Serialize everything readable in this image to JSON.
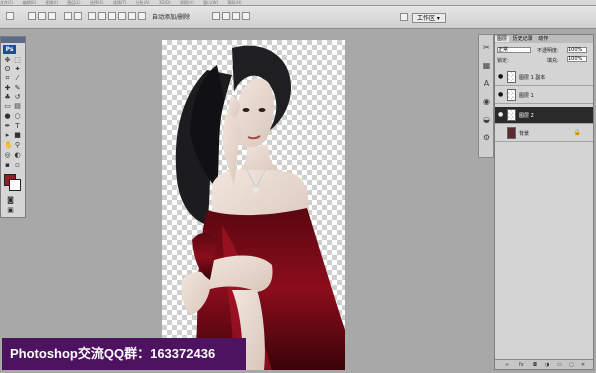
{
  "menubar": [
    "文件(F)",
    "编辑(E)",
    "图像(I)",
    "图层(L)",
    "选择(S)",
    "滤镜(T)",
    "分析(A)",
    "3D(D)",
    "视图(V)",
    "窗口(W)",
    "帮助(H)"
  ],
  "options": {
    "autoadd_label": "自动添加/删除",
    "workspace_label": "工作区 ▾"
  },
  "tools": {
    "logo": "Ps",
    "icons": [
      "move-tool",
      "marquee-tool",
      "lasso-tool",
      "magic-wand-tool",
      "crop-tool",
      "eyedropper-tool",
      "healing-brush-tool",
      "brush-tool",
      "clone-stamp-tool",
      "history-brush-tool",
      "eraser-tool",
      "gradient-tool",
      "blur-tool",
      "dodge-tool",
      "pen-tool",
      "type-tool",
      "path-select-tool",
      "shape-tool",
      "hand-tool",
      "zoom-tool"
    ]
  },
  "colors": {
    "foreground": "#9e1826",
    "background": "#ffffff"
  },
  "layers_panel": {
    "tabs": [
      "图层",
      "历史记录",
      "动作"
    ],
    "blend_mode": "正常",
    "opacity_label": "不透明度:",
    "opacity_value": "100%",
    "lock_label": "锁定:",
    "fill_label": "填充:",
    "fill_value": "100%",
    "layers": [
      {
        "name": "图层 1 副本",
        "visible": true,
        "selected": false,
        "thumb": "transparent"
      },
      {
        "name": "图层 1",
        "visible": true,
        "selected": false,
        "thumb": "transparent"
      },
      {
        "name": "图层 2",
        "visible": true,
        "selected": true,
        "thumb": "transparent"
      },
      {
        "name": "背景",
        "visible": false,
        "selected": false,
        "thumb": "photo",
        "locked": true
      }
    ]
  },
  "caption": "Photoshop交流QQ群：163372436"
}
